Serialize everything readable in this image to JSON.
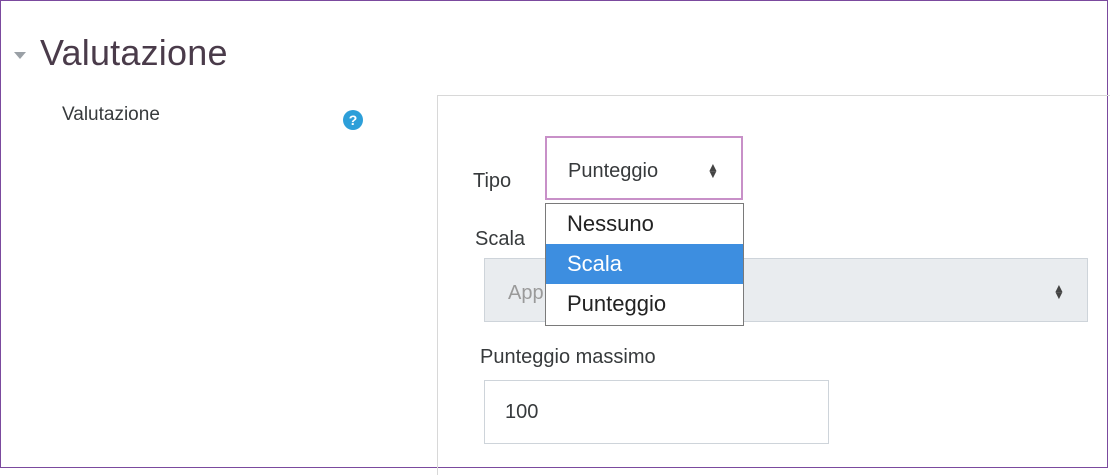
{
  "section": {
    "title": "Valutazione"
  },
  "grade_row": {
    "label": "Valutazione",
    "help_icon": "?"
  },
  "type_field": {
    "label": "Tipo",
    "selected": "Punteggio",
    "options": [
      "Nessuno",
      "Scala",
      "Punteggio"
    ],
    "highlighted": "Scala"
  },
  "scale_field": {
    "label": "Scala",
    "value": "Approvato/Non approvato",
    "visible_fragments": [
      "Ap",
      "provato"
    ]
  },
  "max_grade_field": {
    "label": "Punteggio massimo",
    "value": "100"
  },
  "arrows": "⇕",
  "colors": {
    "accent": "#3d8ee0",
    "help_icon": "#2d9fd9",
    "focus_border": "#c890c8",
    "frame_border": "#7b4a9e"
  }
}
